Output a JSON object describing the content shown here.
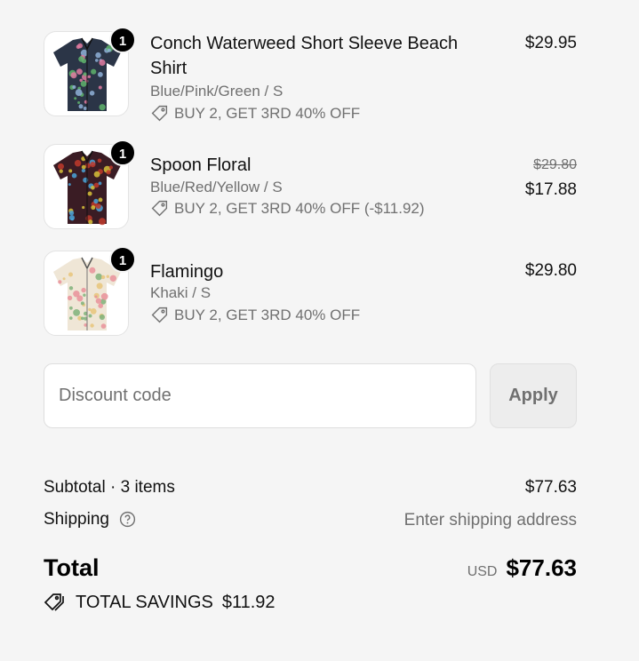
{
  "items": [
    {
      "name": "Conch Waterweed Short Sleeve Beach Shirt",
      "variant": "Blue/Pink/Green / S",
      "promo": "BUY 2, GET 3RD 40% OFF",
      "quantity": "1",
      "price": "$29.95",
      "old_price": "",
      "shirt_color": "#2b3547",
      "pattern_colors": [
        "#e07aa0",
        "#5fb36c",
        "#8fb0d8"
      ]
    },
    {
      "name": "Spoon Floral",
      "variant": "Blue/Red/Yellow / S",
      "promo": "BUY 2, GET 3RD 40% OFF (-$11.92)",
      "quantity": "1",
      "price": "$17.88",
      "old_price": "$29.80",
      "shirt_color": "#3a1c24",
      "pattern_colors": [
        "#d8c23a",
        "#c0392b",
        "#4aa3d8"
      ]
    },
    {
      "name": "Flamingo",
      "variant": "Khaki / S",
      "promo": "BUY 2, GET 3RD 40% OFF",
      "quantity": "1",
      "price": "$29.80",
      "old_price": "",
      "shirt_color": "#efe6d6",
      "pattern_colors": [
        "#e9909a",
        "#7fb27a",
        "#e8c47a"
      ]
    }
  ],
  "discount": {
    "placeholder": "Discount code",
    "apply_label": "Apply"
  },
  "summary": {
    "subtotal_label": "Subtotal · 3 items",
    "subtotal_value": "$77.63",
    "shipping_label": "Shipping",
    "shipping_value": "Enter shipping address",
    "total_label": "Total",
    "currency": "USD",
    "total_value": "$77.63",
    "savings_label": "TOTAL SAVINGS",
    "savings_value": "$11.92"
  },
  "icons": {
    "promo": "tag-icon",
    "shipping_help": "question-circle-icon",
    "savings": "tags-icon"
  }
}
